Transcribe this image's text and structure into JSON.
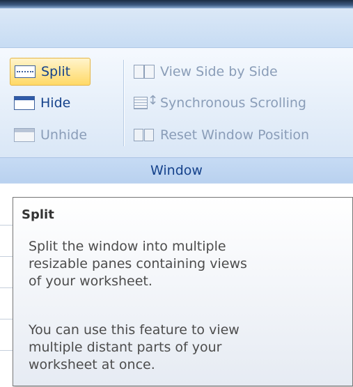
{
  "ribbon": {
    "left_buttons": [
      {
        "label": "Split",
        "icon": "split-window-icon",
        "state": "hover"
      },
      {
        "label": "Hide",
        "icon": "hide-window-icon",
        "state": "enabled"
      },
      {
        "label": "Unhide",
        "icon": "unhide-window-icon",
        "state": "disabled"
      }
    ],
    "right_buttons": [
      {
        "label": "View Side by Side",
        "icon": "side-by-side-icon",
        "state": "disabled"
      },
      {
        "label": "Synchronous Scrolling",
        "icon": "synchronous-scrolling-icon",
        "state": "disabled"
      },
      {
        "label": "Reset Window Position",
        "icon": "reset-window-position-icon",
        "state": "disabled"
      }
    ],
    "group_label": "Window"
  },
  "tooltip": {
    "title": "Split",
    "paragraph1": "Split the window into multiple\nresizable panes containing views\nof your worksheet.",
    "paragraph2": "You can use this feature to view\nmultiple distant parts of your\nworksheet at once."
  },
  "colors": {
    "label_blue": "#15428b",
    "disabled_text": "#8a9db8",
    "hover_fill": "#ffd966"
  }
}
